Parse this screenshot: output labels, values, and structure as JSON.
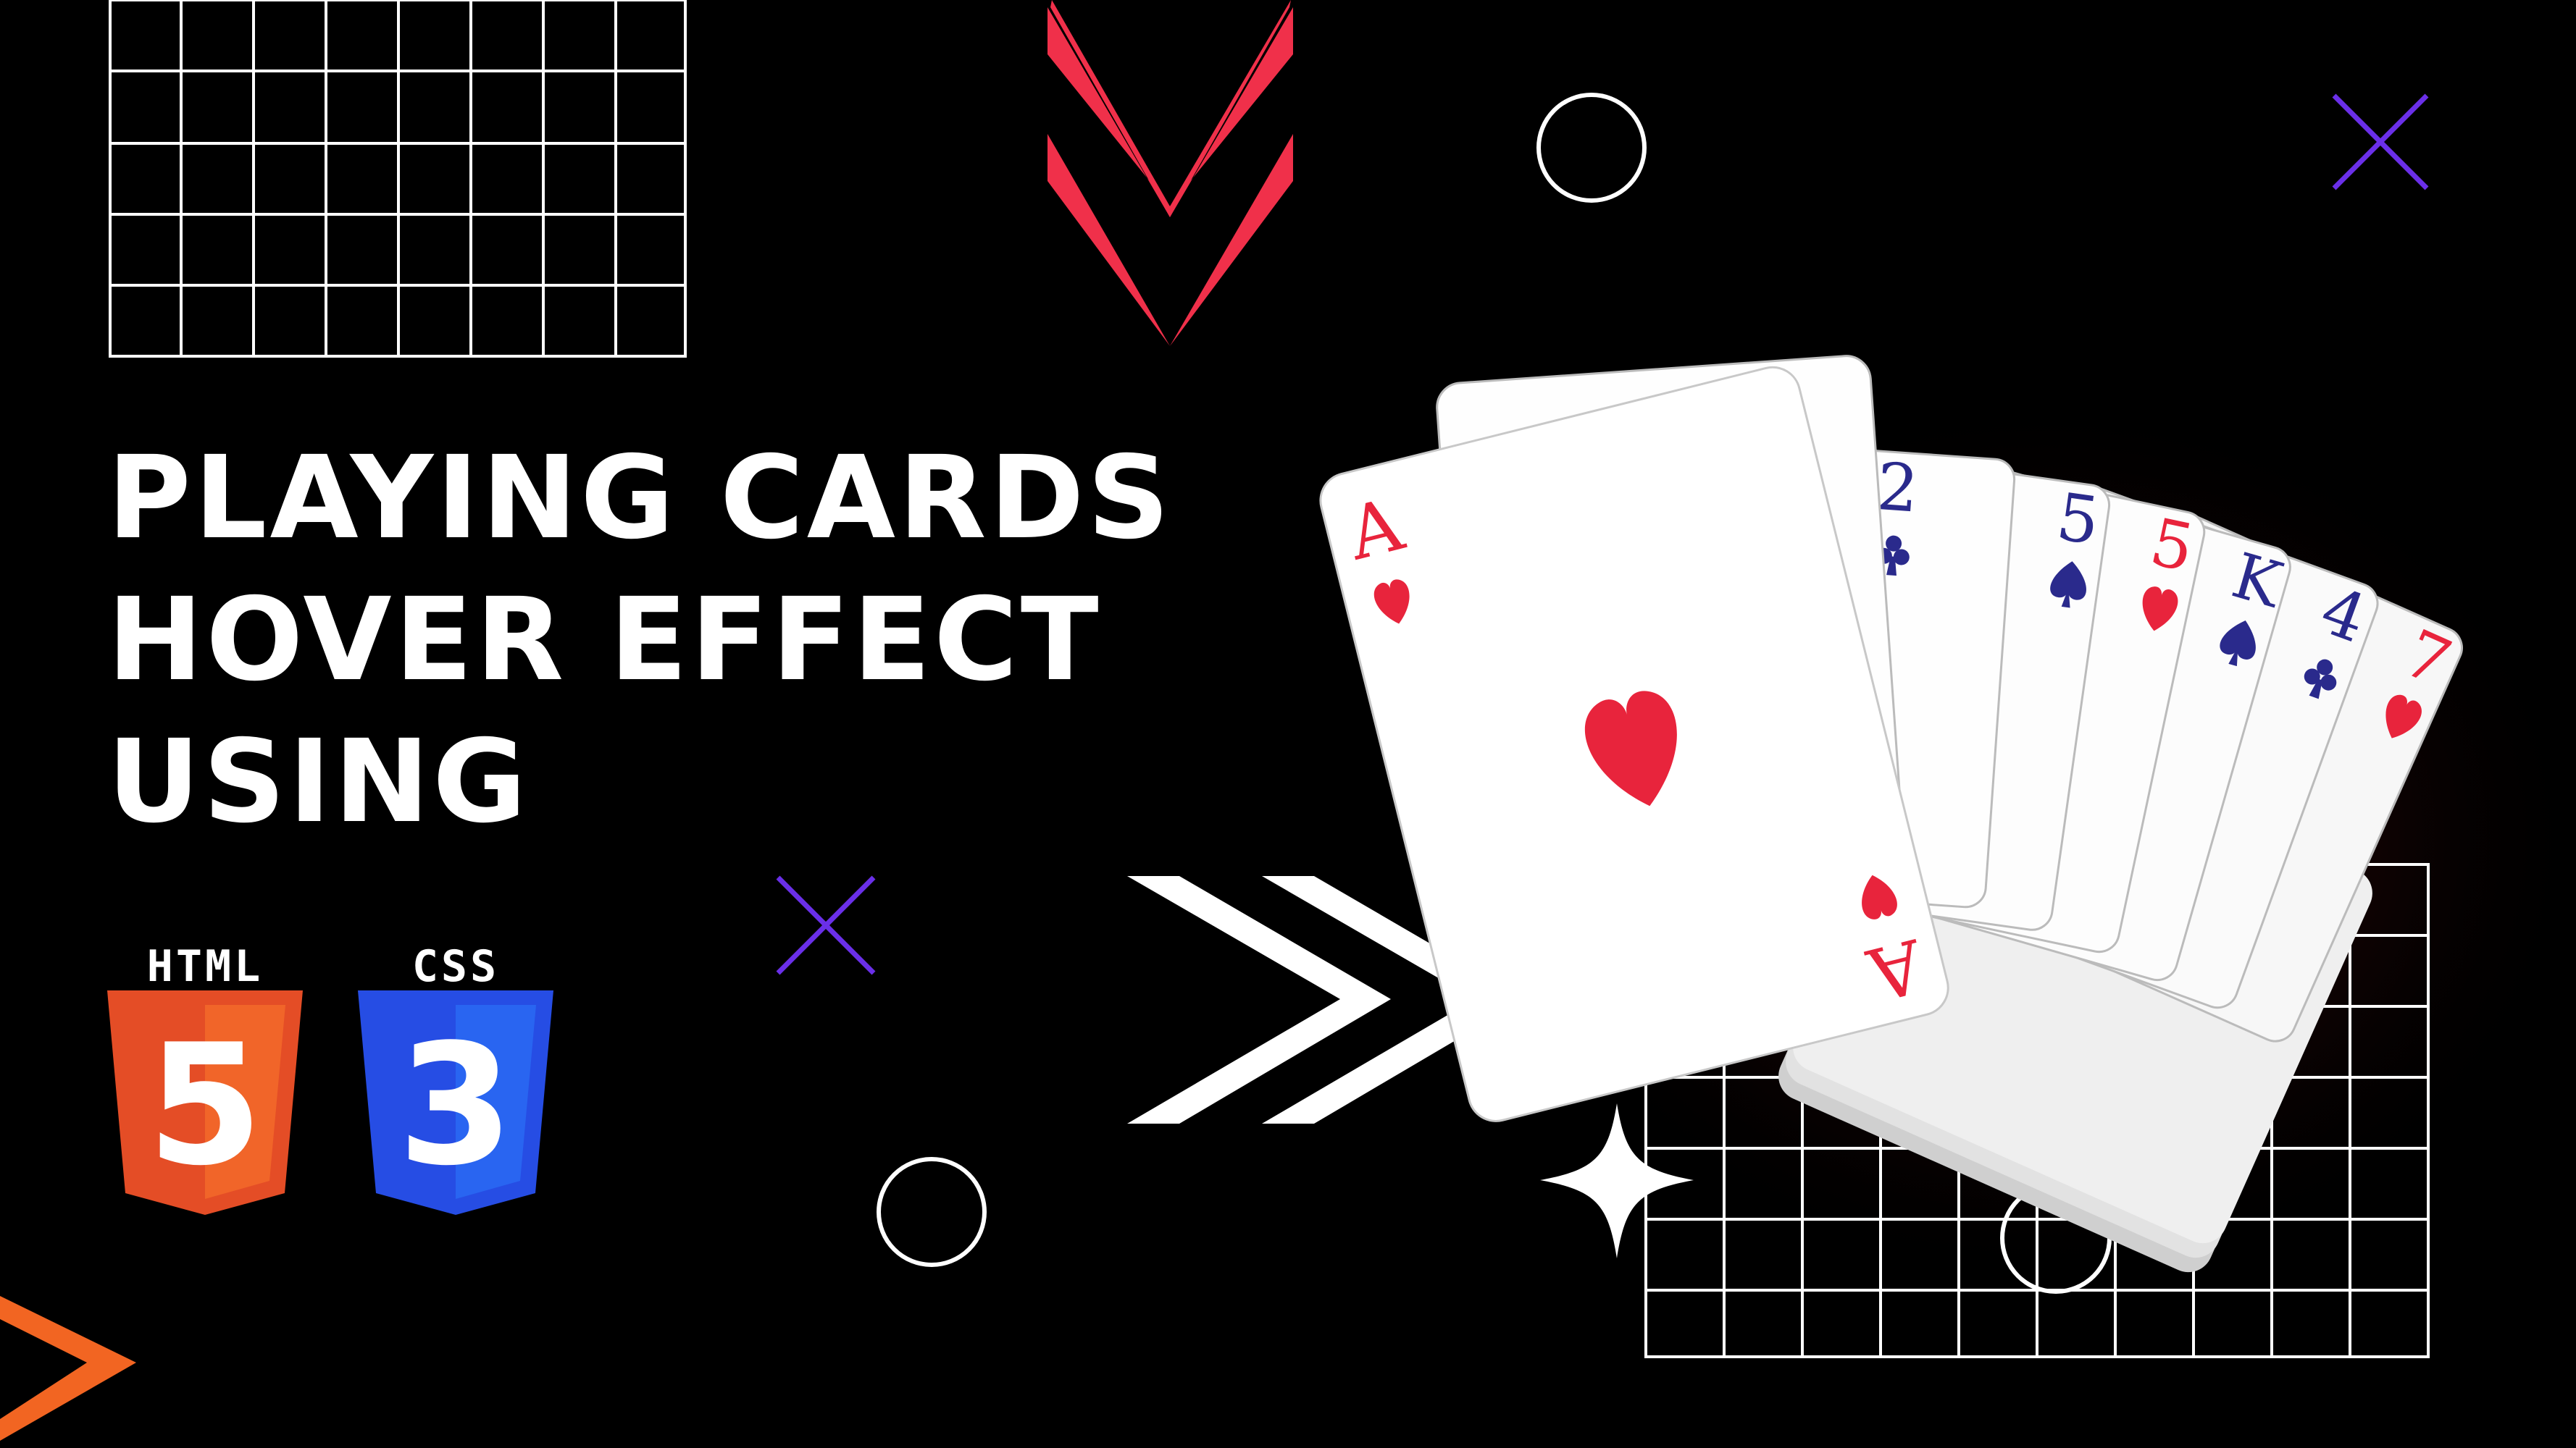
{
  "title": {
    "line1": "PLAYING CARDS",
    "line2": "HOVER EFFECT",
    "line3": "USING"
  },
  "logos": {
    "html": {
      "label": "HTML",
      "icon": "html5-shield-icon",
      "glyph": "5"
    },
    "css": {
      "label": "CSS",
      "icon": "css3-shield-icon",
      "glyph": "3"
    }
  },
  "cards": {
    "front_rank": "A",
    "ranks_in_fan": [
      "2",
      "5",
      "5",
      "K",
      "4",
      "7"
    ],
    "suits": [
      "heart",
      "club",
      "spade",
      "heart",
      "spade",
      "club",
      "heart"
    ]
  },
  "colors": {
    "background": "#000000",
    "title_text": "#ffffff",
    "accent_red": "#f0304a",
    "accent_purple": "#6a2fe8",
    "accent_orange": "#f26522",
    "card_red": "#e8243c",
    "card_blue": "#2a2a8c",
    "html_orange": "#e44d26",
    "css_blue": "#264de4"
  },
  "decorations": [
    "grid-icon",
    "chevron-down-icon",
    "circle-icon",
    "cross-icon",
    "chevron-right-icon",
    "sparkle-icon",
    "triangle-arrow-icon"
  ]
}
